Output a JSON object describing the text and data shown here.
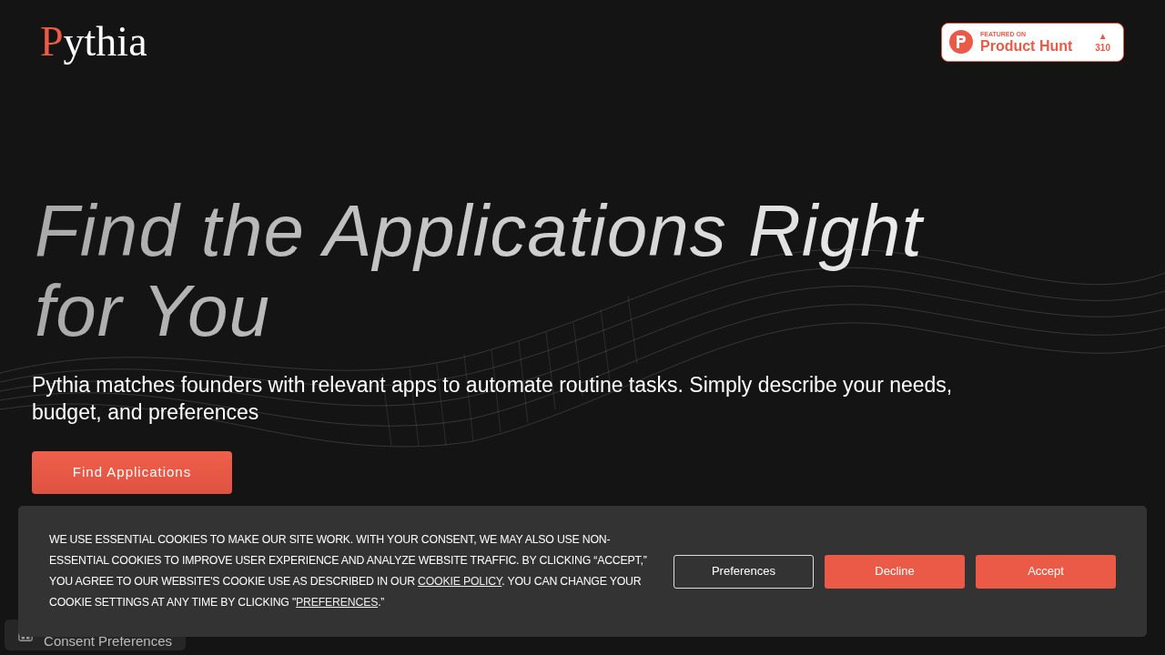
{
  "logo": {
    "initial": "P",
    "rest": "ythia"
  },
  "product_hunt_badge": {
    "eyebrow": "FEATURED ON",
    "name": "Product Hunt",
    "upvote_arrow": "▲",
    "votes": "310"
  },
  "hero": {
    "heading": "Find the Applications Right for You",
    "subtitle": "Pythia matches founders with relevant apps to automate routine tasks. Simply describe your needs, budget, and preferences",
    "cta": "Find Applications"
  },
  "consent_tab": {
    "label": "Consent Preferences"
  },
  "cookie_banner": {
    "text_before": "WE USE ESSENTIAL COOKIES TO MAKE OUR SITE WORK. WITH YOUR CONSENT, WE MAY ALSO USE NON-ESSENTIAL COOKIES TO IMPROVE USER EXPERIENCE AND ANALYZE WEBSITE TRAFFIC. BY CLICKING “ACCEPT,” YOU AGREE TO OUR WEBSITE'S COOKIE USE AS DESCRIBED IN OUR ",
    "policy_link": "COOKIE POLICY",
    "text_middle": ". YOU CAN CHANGE YOUR COOKIE SETTINGS AT ANY TIME BY CLICKING \"",
    "preferences_link": "PREFERENCES",
    "text_after": ".”",
    "buttons": [
      {
        "label": "Preferences",
        "kind": "outline"
      },
      {
        "label": "Decline",
        "kind": "filled"
      },
      {
        "label": "Accept",
        "kind": "filled"
      }
    ]
  }
}
